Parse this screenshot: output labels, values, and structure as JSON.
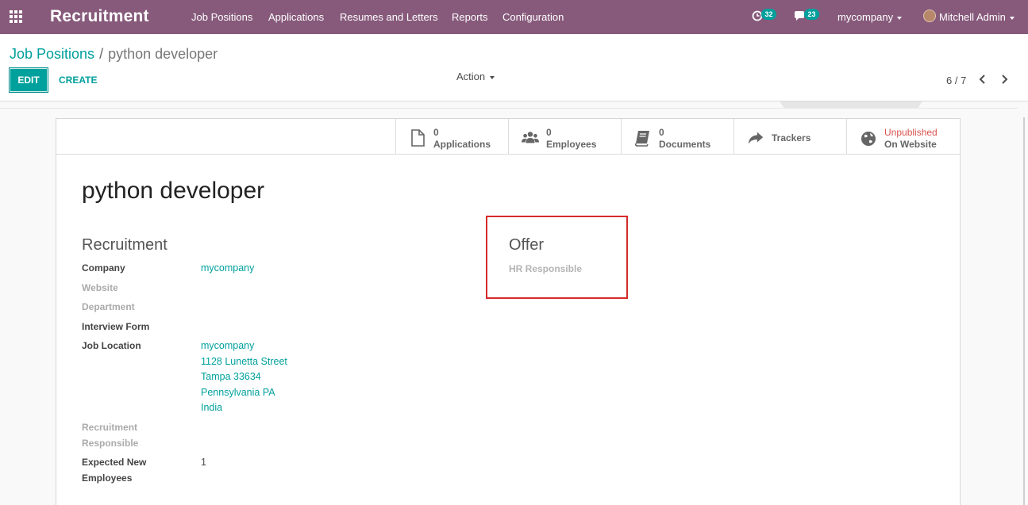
{
  "navbar": {
    "app_title": "Recruitment",
    "menu": [
      "Job Positions",
      "Applications",
      "Resumes and Letters",
      "Reports",
      "Configuration"
    ],
    "activity_count": "32",
    "message_count": "23",
    "company": "mycompany",
    "user": "Mitchell Admin",
    "colors": {
      "bar": "#875a7b",
      "badge": "#00a09d"
    }
  },
  "breadcrumb": {
    "parent": "Job Positions",
    "separator": "/",
    "current": "python developer"
  },
  "toolbar": {
    "edit_label": "EDIT",
    "create_label": "CREATE",
    "action_label": "Action"
  },
  "pager": {
    "value": "6 / 7"
  },
  "smart_buttons": {
    "applications": {
      "count": "0",
      "label": "Applications",
      "icon": "file-icon"
    },
    "employees": {
      "count": "0",
      "label": "Employees",
      "icon": "users-icon"
    },
    "documents": {
      "count": "0",
      "label": "Documents",
      "icon": "book-icon"
    },
    "trackers": {
      "label": "Trackers",
      "icon": "share-arrow-icon"
    },
    "website": {
      "status": "Unpublished",
      "label": "On Website",
      "icon": "globe-icon"
    }
  },
  "form": {
    "title": "python developer",
    "recruitment_group": "Recruitment",
    "offer_group": "Offer",
    "labels": {
      "company": "Company",
      "website": "Website",
      "department": "Department",
      "interview_form": "Interview Form",
      "job_location": "Job Location",
      "recruitment_responsible_1": "Recruitment",
      "recruitment_responsible_2": "Responsible",
      "expected_1": "Expected New",
      "expected_2": "Employees",
      "hr_responsible": "HR Responsible"
    },
    "values": {
      "company": "mycompany",
      "job_location": [
        "mycompany",
        "1128 Lunetta Street",
        "Tampa 33634",
        "Pennsylvania PA",
        "India"
      ],
      "expected_new_employees": "1"
    }
  },
  "highlight_color": "#d52a2a"
}
